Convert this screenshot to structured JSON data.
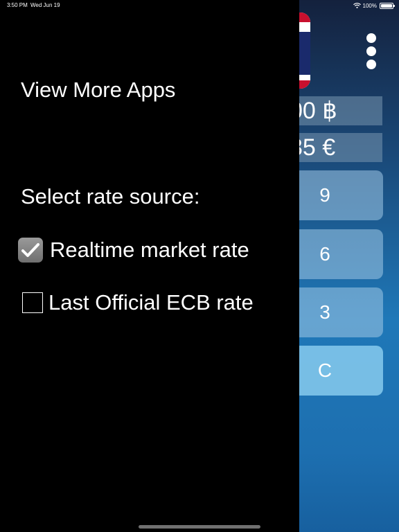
{
  "status_bar": {
    "time": "3:50 PM",
    "date": "Wed Jun 19",
    "battery": "100%"
  },
  "drawer": {
    "view_more_apps": "View More Apps",
    "select_rate_label": "Select rate source:",
    "options": [
      {
        "label": "Realtime market rate",
        "checked": true
      },
      {
        "label": "Last Official ECB rate",
        "checked": false
      }
    ]
  },
  "background_app": {
    "amounts": [
      {
        "text": "00 ฿"
      },
      {
        "text": "35 €"
      }
    ],
    "keys": [
      "9",
      "6",
      "3",
      "C"
    ]
  },
  "colors": {
    "drawer_bg": "#000000",
    "text": "#ffffff",
    "checkbox_fill": "#8a8a8a"
  }
}
